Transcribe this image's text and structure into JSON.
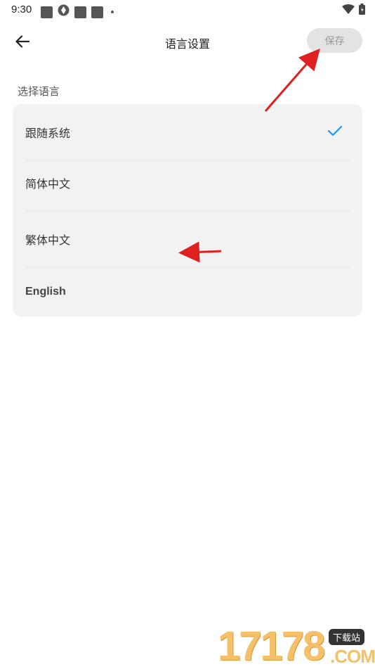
{
  "status_bar": {
    "time": "9:30"
  },
  "header": {
    "title": "语言设置",
    "save_label": "保存"
  },
  "section": {
    "label": "选择语言"
  },
  "languages": [
    {
      "label": "跟随系统",
      "selected": true
    },
    {
      "label": "简体中文",
      "selected": false
    },
    {
      "label": "繁体中文",
      "selected": false
    },
    {
      "label": "English",
      "selected": false
    }
  ],
  "colors": {
    "accent": "#2196f3",
    "annotation_arrow": "#e02020"
  },
  "watermark": {
    "number": "17178",
    "badge": "下载站",
    "domain": ".COM"
  }
}
